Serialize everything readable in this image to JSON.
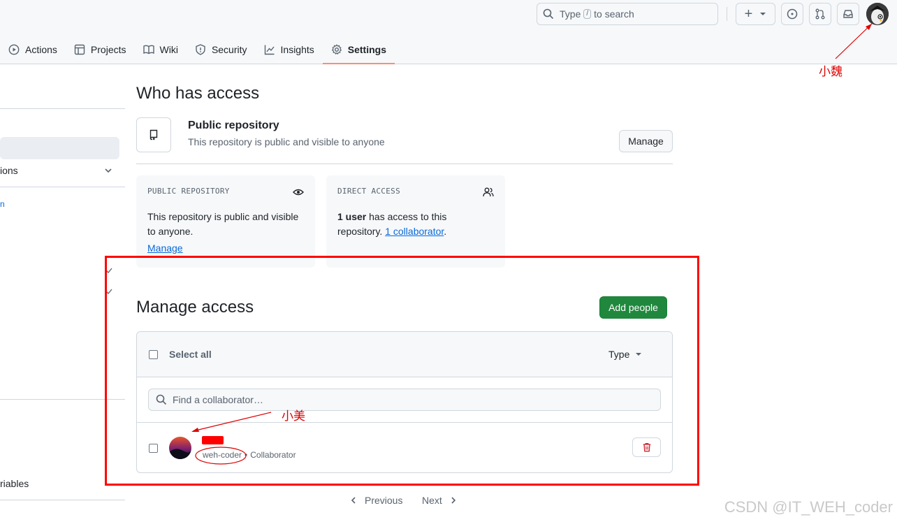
{
  "header": {
    "search_placeholder_prefix": "Type",
    "search_key": "/",
    "search_placeholder_suffix": "to search",
    "plus_label": "+",
    "avatar_annotation": "小魏"
  },
  "tabs": [
    {
      "label": "Actions",
      "icon": "play-icon"
    },
    {
      "label": "Projects",
      "icon": "table-icon"
    },
    {
      "label": "Wiki",
      "icon": "book-icon"
    },
    {
      "label": "Security",
      "icon": "shield-icon"
    },
    {
      "label": "Insights",
      "icon": "graph-icon"
    },
    {
      "label": "Settings",
      "icon": "gear-icon",
      "active": true
    }
  ],
  "sidebar": {
    "item_options": "ions",
    "item_n": "n",
    "item_variables": "riables"
  },
  "who_has_access": {
    "title": "Who has access",
    "visibility_title": "Public repository",
    "visibility_desc": "This repository is public and visible to anyone",
    "manage_label": "Manage",
    "cards": {
      "public": {
        "title": "PUBLIC REPOSITORY",
        "body": "This repository is public and visible to anyone.",
        "link": "Manage"
      },
      "direct": {
        "title": "DIRECT ACCESS",
        "bold": "1 user",
        "body_mid": " has access to this repository. ",
        "link": "1 collaborator",
        "body_end": "."
      }
    }
  },
  "manage_access": {
    "title": "Manage access",
    "add_people": "Add people",
    "select_all": "Select all",
    "type_filter": "Type",
    "find_placeholder": "Find a collaborator…",
    "collaborator": {
      "username": "weh-coder",
      "separator": "•",
      "role": "Collaborator",
      "annotation": "小美"
    }
  },
  "pagination": {
    "previous": "Previous",
    "next": "Next"
  },
  "watermark": "CSDN @IT_WEH_coder",
  "colors": {
    "accent_green": "#1f883d",
    "link_blue": "#0969da",
    "annotation_red": "#ff0000",
    "danger": "#cf222e"
  }
}
